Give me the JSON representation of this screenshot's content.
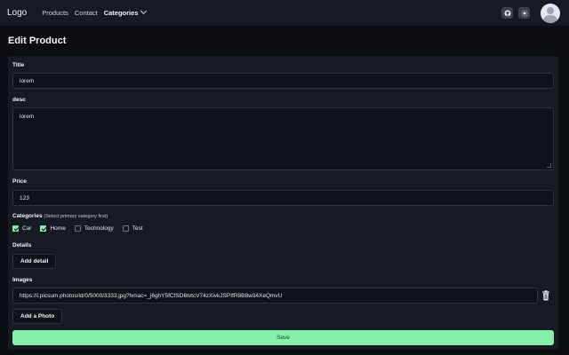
{
  "navbar": {
    "logo": "Logo",
    "links": [
      "Products",
      "Contact",
      "Categories"
    ]
  },
  "page": {
    "title": "Edit Product"
  },
  "form": {
    "title_label": "Title",
    "title_value": "lorem",
    "desc_label": "desc",
    "desc_value": "lorem",
    "price_label": "Price",
    "price_value": "123",
    "categories_label": "Categories",
    "categories_hint": "(Select primary category first)",
    "categories": [
      {
        "label": "Car",
        "checked": true
      },
      {
        "label": "Home",
        "checked": true
      },
      {
        "label": "Technology",
        "checked": false
      },
      {
        "label": "Test",
        "checked": false
      }
    ],
    "details_label": "Details",
    "add_detail_label": "Add detail",
    "images_label": "Images",
    "image_url": "https://i.picsum.photos/id/0/5000/3333.jpg?hmac=_j6ghY5fCfSD6tvtcV74zXivkJSPIfR9B8w34XeQmvU",
    "add_photo_label": "Add a Photo",
    "save_label": "Save"
  },
  "colors": {
    "accent": "#86efac",
    "background": "#0b0d12",
    "surface": "#161a22"
  },
  "icons": [
    "github-icon",
    "sun-icon",
    "user-avatar-icon",
    "chevron-down-icon",
    "trash-icon"
  ]
}
